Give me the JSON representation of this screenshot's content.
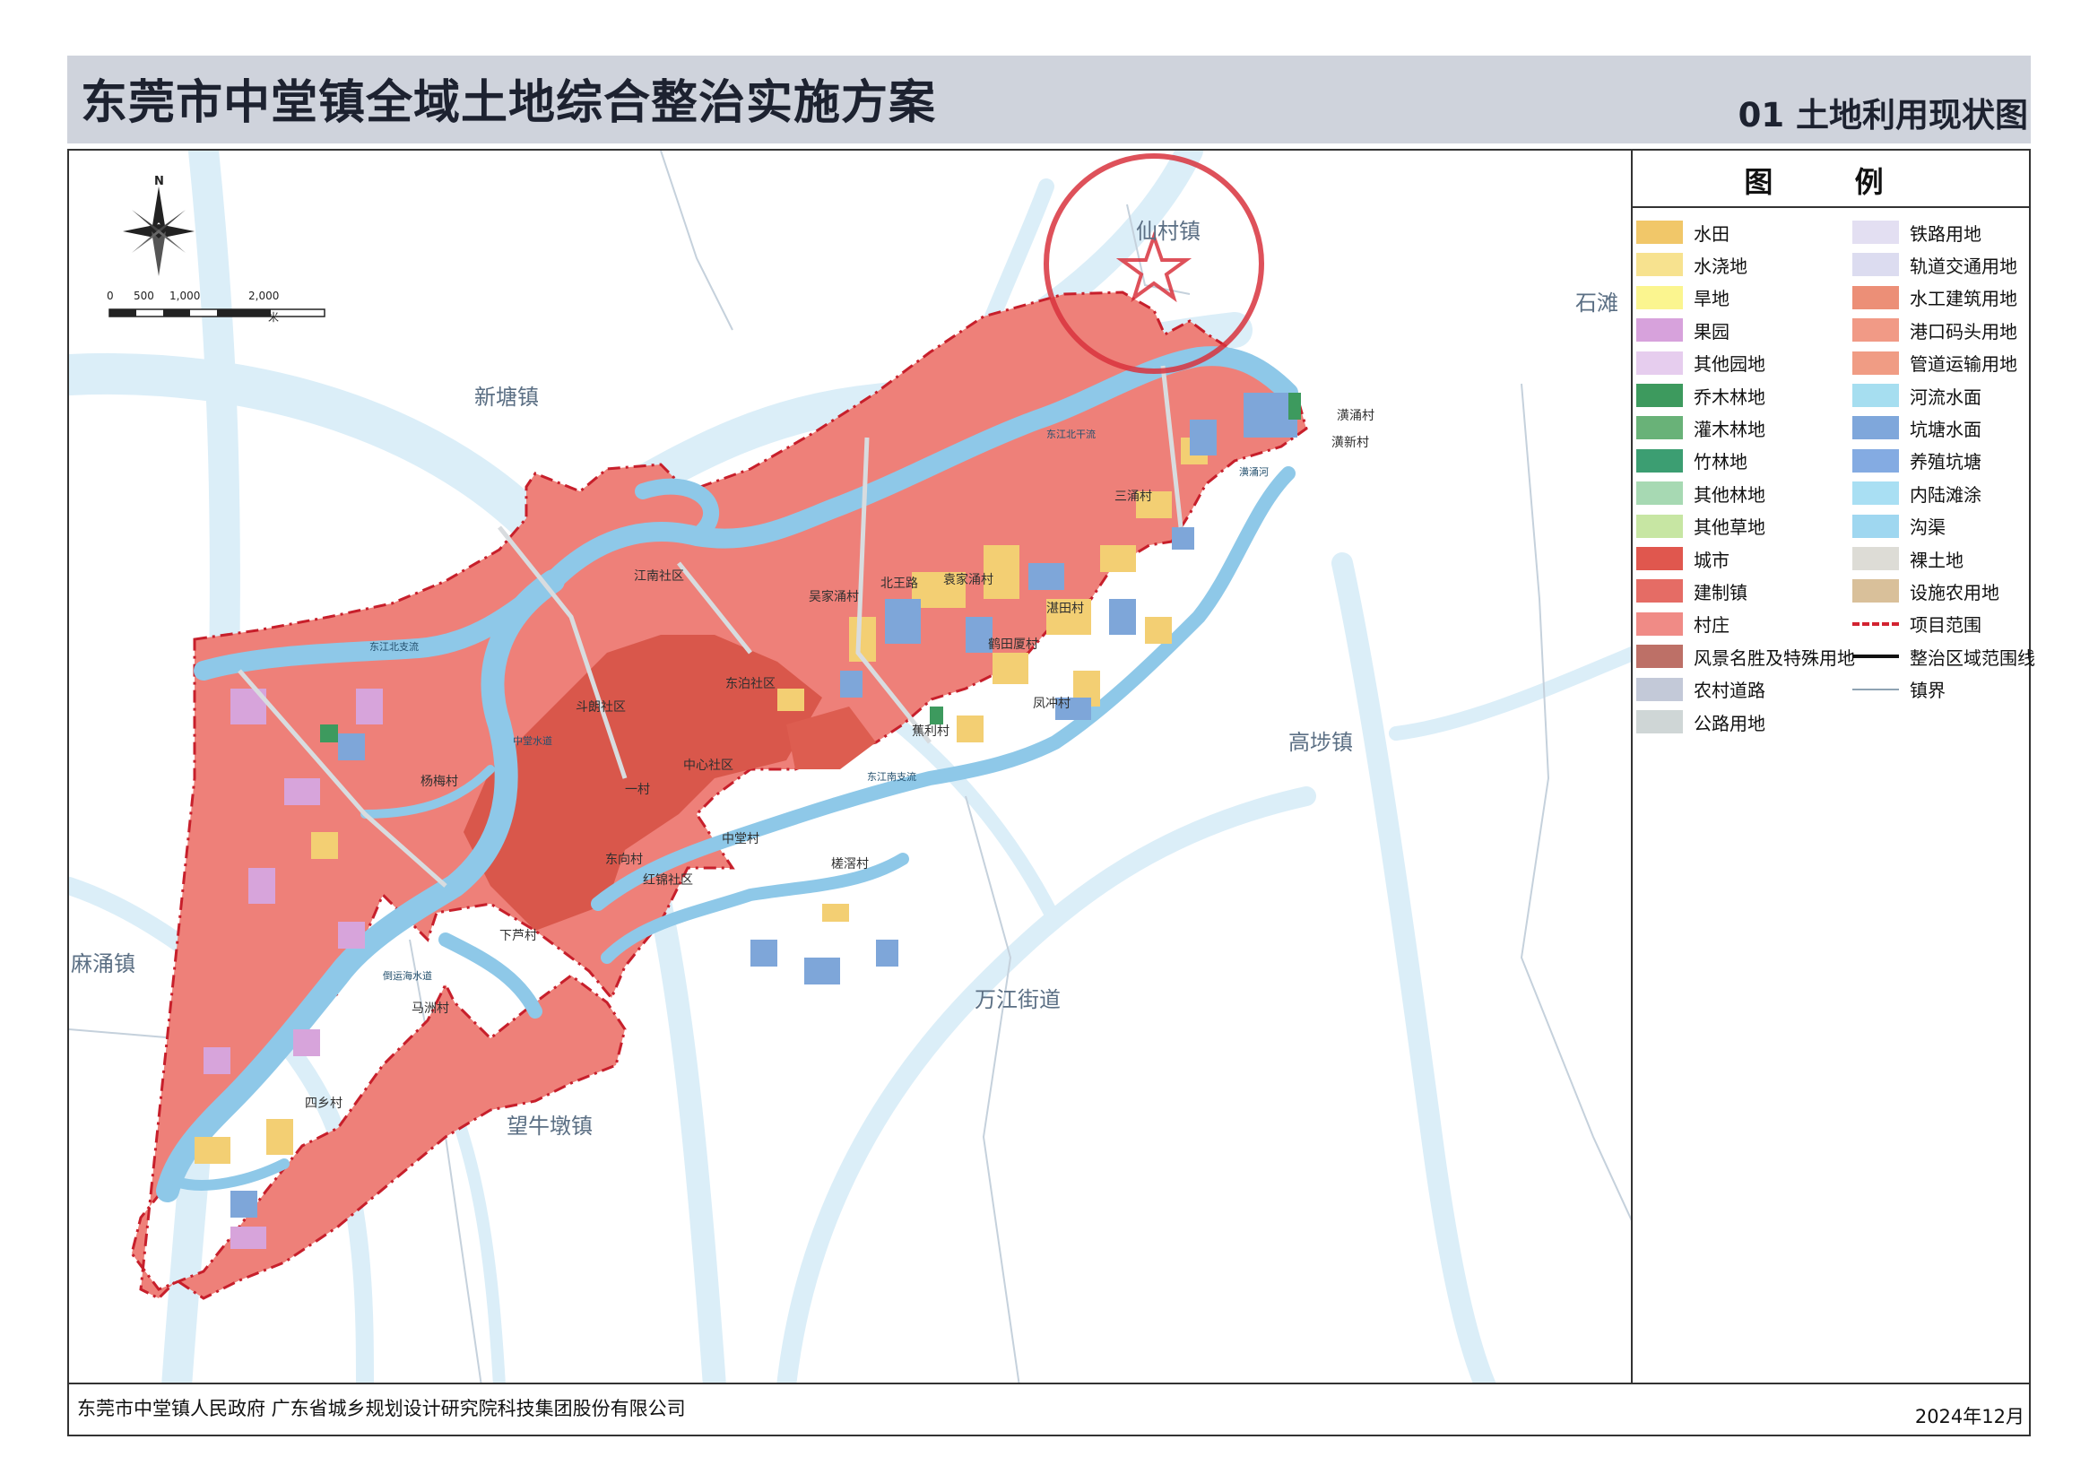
{
  "header": {
    "title": "东莞市中堂镇全域土地综合整治实施方案",
    "sheet": "01  土地利用现状图"
  },
  "map": {
    "north_label": "N",
    "scale_labels": [
      "0",
      "500",
      "1,000",
      "2,000"
    ],
    "scale_unit": "米",
    "neighbors": [
      "仙村镇",
      "新塘镇",
      "石滩",
      "高埗镇",
      "麻涌镇",
      "万江街道",
      "望牛墩镇"
    ],
    "villages": [
      "江南社区",
      "斗朗社区",
      "东泊社区",
      "中心社区",
      "一村",
      "东向村",
      "三涌村",
      "潢涌村",
      "袁家涌村",
      "北王路",
      "吴家涌村",
      "湛田村",
      "鹤田厦村",
      "凤冲村",
      "蕉利村",
      "中堂村",
      "槎滘村",
      "杨梅村",
      "四乡村",
      "马洲村",
      "下芦村",
      "红锦社区",
      "潢新村"
    ],
    "rivers": [
      "东江北支流",
      "东江北干流",
      "东江南支流",
      "倒运海水道",
      "中堂水道",
      "潢涌河"
    ],
    "seal_text": "东莞市中堂镇人民政府",
    "colors": {
      "water": "#8ec8e8",
      "village": "#ee8079",
      "town": "#d9574b",
      "boundary": "#d22331",
      "paddy": "#f3cf73",
      "pond": "#7ea6d9",
      "orchard": "#d7a4db"
    }
  },
  "legend": {
    "title": "图  例",
    "left": [
      {
        "label": "水田",
        "color": "#f1c769"
      },
      {
        "label": "水浇地",
        "color": "#f7e28f"
      },
      {
        "label": "旱地",
        "color": "#fbf58f"
      },
      {
        "label": "果园",
        "color": "#d7a2dc"
      },
      {
        "label": "其他园地",
        "color": "#e6cdee"
      },
      {
        "label": "乔木林地",
        "color": "#3d9a5e"
      },
      {
        "label": "灌木林地",
        "color": "#69b278"
      },
      {
        "label": "竹林地",
        "color": "#3c9e72"
      },
      {
        "label": "其他林地",
        "color": "#a7d9b3"
      },
      {
        "label": "其他草地",
        "color": "#c7e6a3"
      },
      {
        "label": "城市",
        "color": "#e0574e"
      },
      {
        "label": "建制镇",
        "color": "#e56c65"
      },
      {
        "label": "村庄",
        "color": "#f08b86"
      },
      {
        "label": "风景名胜及特殊用地",
        "color": "#bd7067"
      },
      {
        "label": "农村道路",
        "color": "#c3c9d8"
      },
      {
        "label": "公路用地",
        "color": "#cfd6d6"
      }
    ],
    "right": [
      {
        "label": "铁路用地",
        "color": "#e3dff2"
      },
      {
        "label": "轨道交通用地",
        "color": "#dcdcf0"
      },
      {
        "label": "水工建筑用地",
        "color": "#ec8f77"
      },
      {
        "label": "港口码头用地",
        "color": "#f19a86"
      },
      {
        "label": "管道运输用地",
        "color": "#f09c84"
      },
      {
        "label": "河流水面",
        "color": "#a6def0"
      },
      {
        "label": "坑塘水面",
        "color": "#7fa7db"
      },
      {
        "label": "养殖坑塘",
        "color": "#84abe2"
      },
      {
        "label": "内陆滩涂",
        "color": "#a9dff3"
      },
      {
        "label": "沟渠",
        "color": "#9fd7f0"
      },
      {
        "label": "裸土地",
        "color": "#dddcd6"
      },
      {
        "label": "设施农用地",
        "color": "#d9c09a"
      },
      {
        "label": "项目范围",
        "color": "#d22331"
      },
      {
        "label": "整治区域范围线",
        "color": "#111111"
      },
      {
        "label": "镇界",
        "color": "#8fa3b3"
      }
    ]
  },
  "footer": {
    "org": "东莞市中堂镇人民政府    广东省城乡规划设计研究院科技集团股份有限公司",
    "date": "2024年12月"
  }
}
